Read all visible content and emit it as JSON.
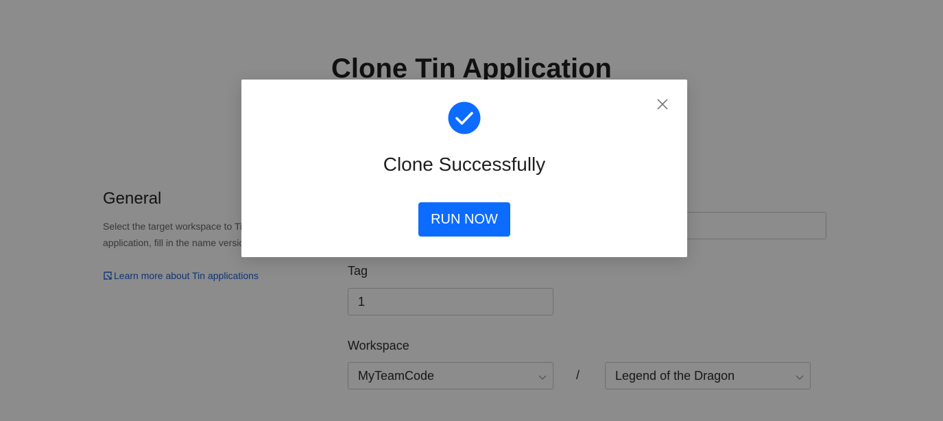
{
  "page": {
    "title": "Clone Tin Application",
    "general": {
      "heading": "General",
      "description": "Select the target workspace to Tin application, fill in the name version",
      "learn_more": "Learn more about Tin applications"
    },
    "fields": {
      "tag": {
        "label": "Tag",
        "value": "1"
      },
      "workspace": {
        "label": "Workspace",
        "team_value": "MyTeamCode",
        "separator": "/",
        "project_value": "Legend of the Dragon"
      }
    }
  },
  "modal": {
    "message": "Clone Successfully",
    "run_button": "RUN NOW",
    "icons": {
      "status": "check-circle-icon",
      "close": "close-icon"
    },
    "accent_color": "#0b6cff"
  }
}
